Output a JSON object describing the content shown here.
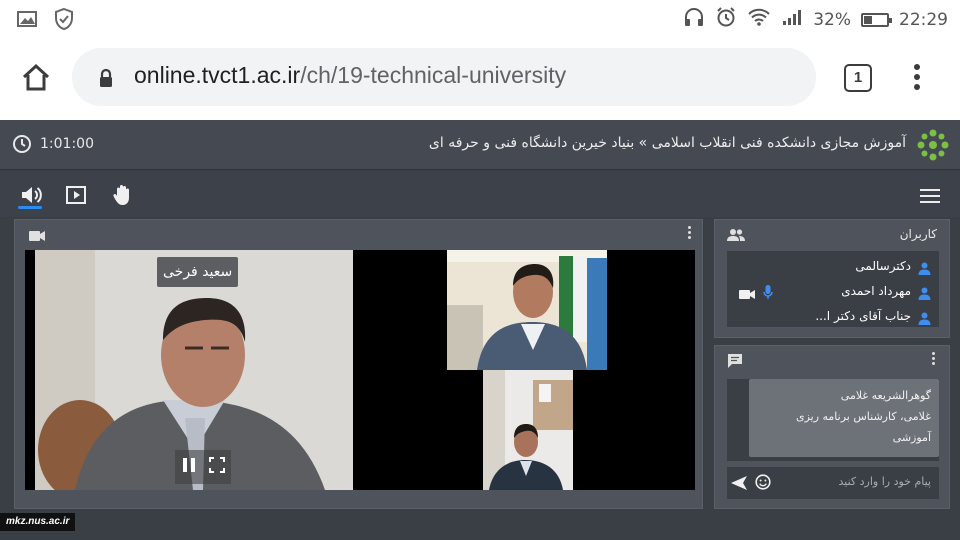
{
  "status_bar": {
    "battery_percent": "32%",
    "battery_level": 0.32,
    "time": "22:29",
    "icons": [
      "image-icon",
      "shield-icon",
      "headphones-icon",
      "alarm-icon",
      "wifi-icon",
      "signal-icon",
      "battery-icon"
    ]
  },
  "browser": {
    "url_host": "online.tvct1.ac.ir",
    "url_path": "/ch/19-technical-university",
    "tab_count": "1"
  },
  "app_header": {
    "timer": "1:01:00",
    "title": "آموزش مجازی دانشکده فنی انقلاب اسلامی » بنیاد خیرین دانشگاه فنی و حرفه ای"
  },
  "video": {
    "main_speaker_name": "سعید فرخی"
  },
  "users_panel": {
    "title": "کاربران",
    "users": [
      {
        "name": "دکترسالمی"
      },
      {
        "name": "مهرداد احمدی"
      },
      {
        "name": "جناب آقای دکتر ا..."
      }
    ]
  },
  "chat_panel": {
    "message_author": "گوهرالشریعه غلامی",
    "message_text": "غلامی، کارشناس برنامه ریزی آموزشی",
    "input_placeholder": "پیام خود را وارد کنید"
  },
  "watermark": "mkz.nus.ac.ir",
  "colors": {
    "app_bg": "#3a3f46",
    "header_bg": "#454a52",
    "panel_bg": "#4f545c",
    "accent_blue": "#2a8bf2",
    "logo_green": "#7ac143"
  }
}
